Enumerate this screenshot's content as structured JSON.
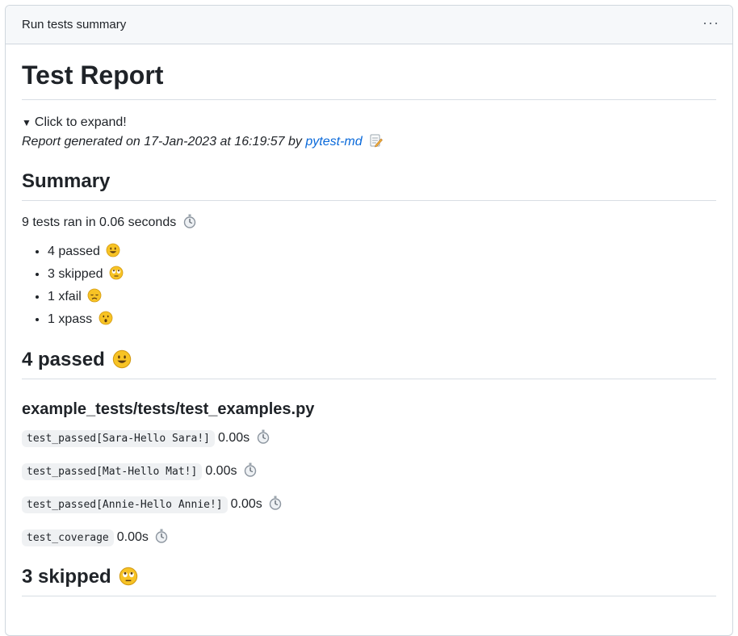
{
  "header": {
    "title": "Run tests summary",
    "menu_icon": "kebab-horizontal-icon"
  },
  "report": {
    "title": "Test Report",
    "expand_label": "Click to expand!",
    "generated_prefix": "Report generated on 17-Jan-2023 at 16:19:57 by ",
    "generated_link": "pytest-md"
  },
  "summary": {
    "heading": "Summary",
    "ran_line": "9 tests ran in 0.06 seconds",
    "counts": [
      {
        "label": "4 passed",
        "icon": "smiley-icon"
      },
      {
        "label": "3 skipped",
        "icon": "eye-roll-icon"
      },
      {
        "label": "1 xfail",
        "icon": "disappointed-icon"
      },
      {
        "label": "1 xpass",
        "icon": "astonished-icon"
      }
    ]
  },
  "passed": {
    "heading": "4 passed",
    "file": "example_tests/tests/test_examples.py",
    "tests": [
      {
        "name": "test_passed[Sara-Hello Sara!]",
        "duration": "0.00s"
      },
      {
        "name": "test_passed[Mat-Hello Mat!]",
        "duration": "0.00s"
      },
      {
        "name": "test_passed[Annie-Hello Annie!]",
        "duration": "0.00s"
      },
      {
        "name": "test_coverage",
        "duration": "0.00s"
      }
    ]
  },
  "skipped": {
    "heading": "3 skipped"
  },
  "colors": {
    "link": "#0969da",
    "border": "#d0d7de",
    "header_bg": "#f6f8fa",
    "emoji": "#f7c325"
  }
}
